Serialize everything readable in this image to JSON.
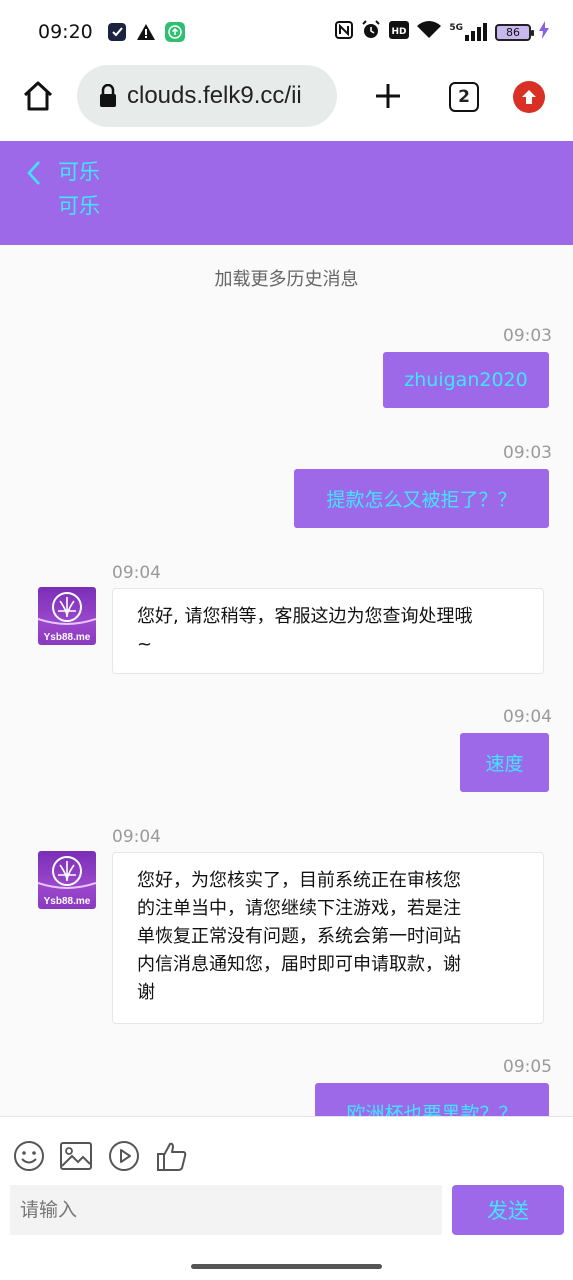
{
  "status_bar": {
    "time": "09:20",
    "battery": "86",
    "network": "5G"
  },
  "browser": {
    "url": "clouds.felk9.cc/ii",
    "tab_count": "2"
  },
  "chat": {
    "title": "可乐",
    "subtitle": "可乐",
    "load_more": "加载更多历史消息",
    "agent_avatar_label": "Ysb88.me",
    "messages": [
      {
        "time": "09:03",
        "text": "zhuigan2020",
        "direction": "out"
      },
      {
        "time": "09:03",
        "text": "提款怎么又被拒了？？",
        "direction": "out"
      },
      {
        "time": "09:04",
        "lines": [
          "您好, 请您稍等，客服这边为您查询处理哦",
          "~"
        ],
        "direction": "in"
      },
      {
        "time": "09:04",
        "text": "速度",
        "direction": "out"
      },
      {
        "time": "09:04",
        "lines": [
          "您好，为您核实了，目前系统正在审核您",
          "的注单当中，请您继续下注游戏，若是注",
          "单恢复正常没有问题，系统会第一时间站",
          "内信消息通知您，届时即可申请取款，谢",
          "谢"
        ],
        "direction": "in"
      },
      {
        "time": "09:05",
        "text": "欧洲杯也要黑款？？",
        "direction": "out"
      }
    ]
  },
  "composer": {
    "placeholder": "请输入",
    "send_label": "发送",
    "tools": [
      "emoji-icon",
      "image-icon",
      "play-icon",
      "thumbs-up-icon"
    ]
  },
  "colors": {
    "accent": "#9e69e9",
    "accent_text": "#3ee6ff"
  }
}
